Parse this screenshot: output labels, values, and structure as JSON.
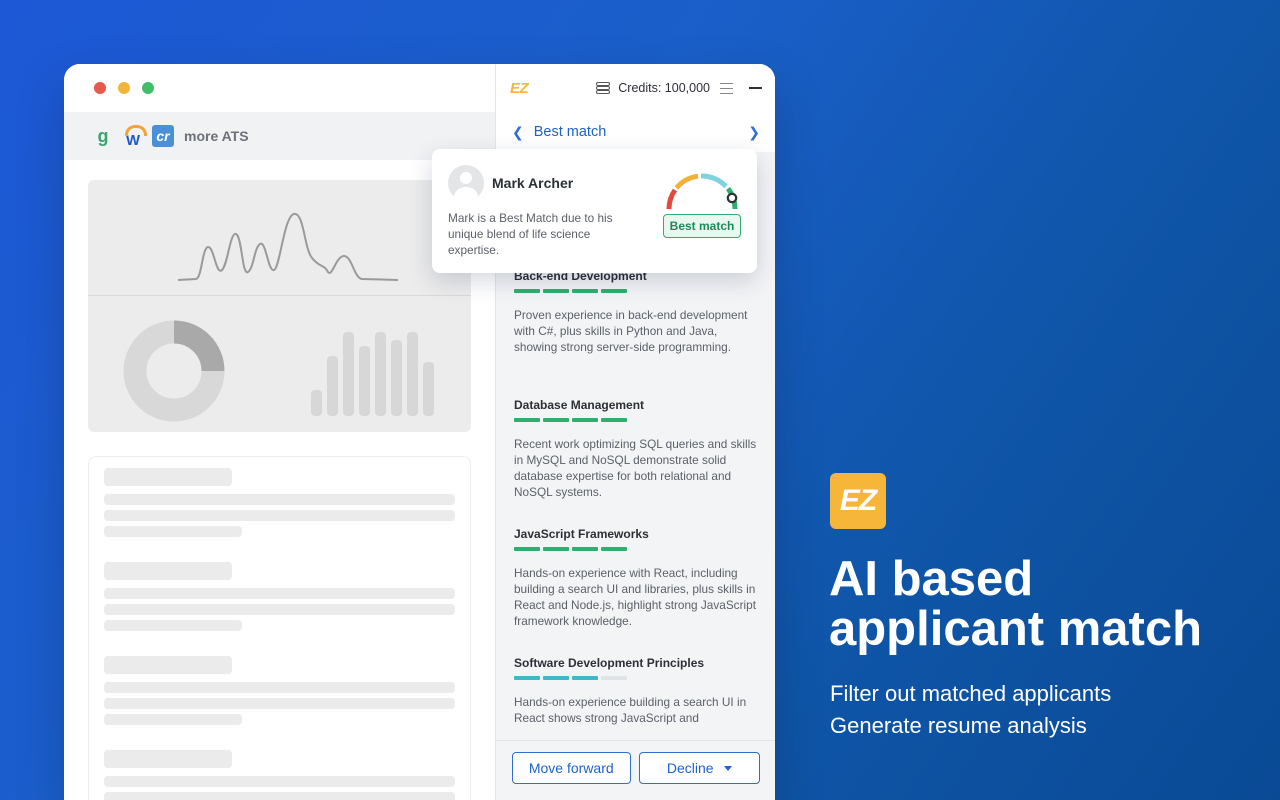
{
  "ats_bar": {
    "logos": [
      "greenhouse-logo",
      "workday-logo",
      "crelate-logo"
    ],
    "logo_glyphs": [
      "g",
      "W",
      "cr"
    ],
    "more_label": "more ATS"
  },
  "extension": {
    "logo_text": "EZ",
    "credits_label": "Credits: 100,000",
    "nav_title": "Best match",
    "candidate": {
      "name": "Mark Archer",
      "summary": "Mark is a Best Match due to his unique blend of life science expertise.",
      "match_badge": "Best match"
    },
    "skills": [
      {
        "title": "Back-end Development",
        "level": 4,
        "color": "green",
        "description": "Proven experience in back-end development with C#, plus skills in Python and Java, showing strong server-side programming."
      },
      {
        "title": "Database Management",
        "level": 4,
        "color": "green",
        "description": "Recent work optimizing SQL queries and skills in MySQL and NoSQL demonstrate solid database expertise for both relational and NoSQL systems."
      },
      {
        "title": "JavaScript Frameworks",
        "level": 4,
        "color": "green",
        "description": "Hands-on experience with React, including building a search UI and libraries, plus skills in React and Node.js, highlight strong JavaScript framework knowledge."
      },
      {
        "title": "Software Development Principles",
        "level": 3,
        "color": "teal",
        "description": "Hands-on experience building a search UI in React shows strong JavaScript and"
      }
    ],
    "buttons": {
      "move_forward": "Move forward",
      "decline": "Decline"
    },
    "colors": {
      "accent": "#1e63c9",
      "match_green": "#2fae6f",
      "teal": "#3db7c9",
      "brand_yellow": "#f5b63a"
    }
  },
  "promo": {
    "logo_text": "EZ",
    "headline_line1": "AI based",
    "headline_line2": "applicant match",
    "sub_line1": "Filter out matched applicants",
    "sub_line2": "Generate resume analysis"
  }
}
